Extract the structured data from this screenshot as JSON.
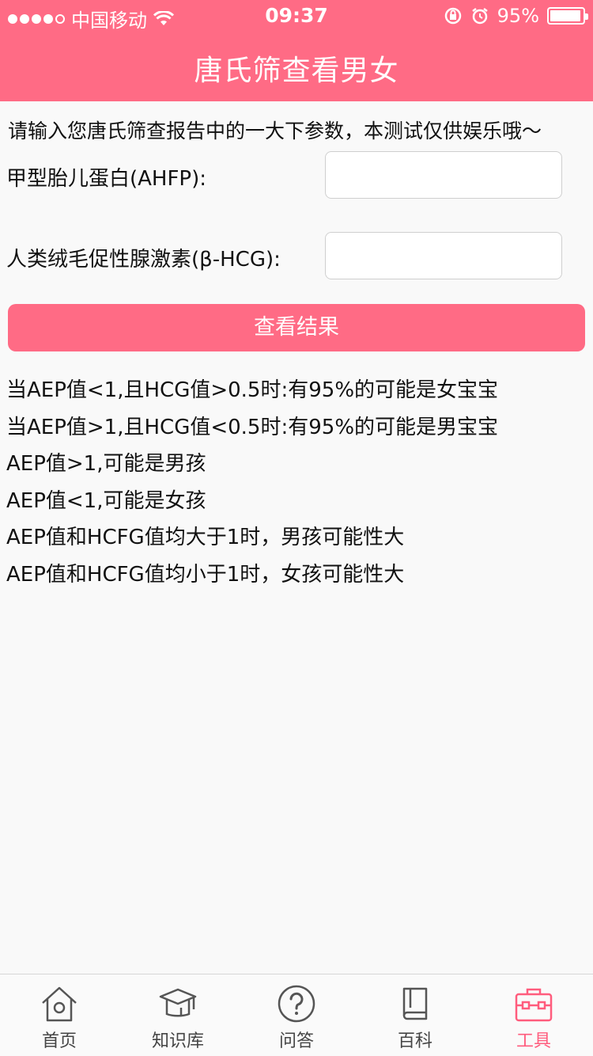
{
  "status_bar": {
    "carrier": "中国移动",
    "time": "09:37",
    "battery": "95%",
    "battery_level": 0.95
  },
  "header": {
    "title": "唐氏筛查看男女"
  },
  "intro": "请输入您唐氏筛查报告中的一大下参数，本测试仅供娱乐哦～",
  "form": {
    "afp_label": "甲型胎儿蛋白(AHFP):",
    "afp_value": "",
    "hcg_label": "人类绒毛促性腺激素(β-HCG):",
    "hcg_value": "",
    "submit_label": "查看结果"
  },
  "rules": [
    "当AEP值<1,且HCG值>0.5时:有95%的可能是女宝宝",
    "当AEP值>1,且HCG值<0.5时:有95%的可能是男宝宝",
    "AEP值>1,可能是男孩",
    "AEP值<1,可能是女孩",
    "AEP值和HCFG值均大于1时，男孩可能性大",
    "AEP值和HCFG值均小于1时，女孩可能性大"
  ],
  "tabs": [
    {
      "label": "首页",
      "icon": "home-icon"
    },
    {
      "label": "知识库",
      "icon": "graduation-cap-icon"
    },
    {
      "label": "问答",
      "icon": "question-icon"
    },
    {
      "label": "百科",
      "icon": "book-icon"
    },
    {
      "label": "工具",
      "icon": "toolbox-icon",
      "active": true
    }
  ],
  "colors": {
    "accent": "#ff6b85",
    "active_tab": "#ff5c7d"
  }
}
